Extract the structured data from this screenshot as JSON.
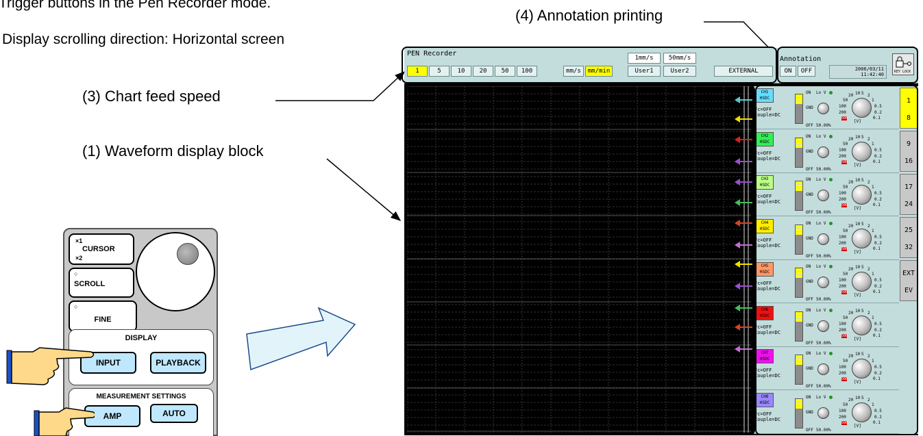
{
  "captions": {
    "line1": "Trigger buttons in the Pen Recorder mode.",
    "line2": "Display scrolling direction: Horizontal screen"
  },
  "callouts": {
    "annotation_printing": "(4) Annotation printing",
    "chart_feed_speed": "(3) Chart feed speed",
    "waveform_display_block": "(1) Waveform display block"
  },
  "screen": {
    "mode_title": "PEN Recorder",
    "speed_buttons": [
      {
        "label": "1",
        "selected": true
      },
      {
        "label": "5",
        "selected": false
      },
      {
        "label": "10",
        "selected": false
      },
      {
        "label": "20",
        "selected": false
      },
      {
        "label": "50",
        "selected": false
      },
      {
        "label": "100",
        "selected": false
      }
    ],
    "unit_mms": "mm/s",
    "unit_mmmin": "mm/min",
    "user_speeds": [
      "1mm/s",
      "50mm/s"
    ],
    "user1": "User1",
    "user2": "User2",
    "external": "EXTERNAL",
    "annotation": {
      "label": "Annotation",
      "on": "ON",
      "off": "OFF",
      "date": "2006/03/11",
      "time": "11:42:40"
    },
    "key_lock": "KEY LOCK",
    "side_tabs": [
      {
        "top": "1",
        "bottom": "8",
        "selected": true
      },
      {
        "top": "9",
        "bottom": "16",
        "selected": false
      },
      {
        "top": "17",
        "bottom": "24",
        "selected": false
      },
      {
        "top": "25",
        "bottom": "32",
        "selected": false
      },
      {
        "top": "EXT",
        "bottom": "EV",
        "selected": false
      }
    ],
    "channel_common": {
      "filter": "Fc=OFF",
      "coupling": "Couple=DC",
      "on": "ON",
      "lov": "Lo V",
      "gnd": "GND",
      "off": "OFF",
      "position": "50.00%",
      "range_unit": "[V]",
      "range_value": "500",
      "scale_20": "20",
      "scale_10": "10",
      "scale_5": "5",
      "scale_2": "2",
      "scale_50": "50",
      "scale_1": "1",
      "scale_100": "100",
      "scale_05": "0.5",
      "scale_200": "200",
      "scale_02": "0.2",
      "scale_01": "0.1"
    },
    "channels": [
      {
        "name": "CH1",
        "type": "HSDC",
        "color": "#66ddff",
        "marker": "#5bc8c8"
      },
      {
        "name": "CH2",
        "type": "HSDC",
        "color": "#33ee55",
        "marker": "#f0e000"
      },
      {
        "name": "CH3",
        "type": "HSDC",
        "color": "#bbff88",
        "marker": "#e02020"
      },
      {
        "name": "CH4",
        "type": "HSDC",
        "color": "#ffee00",
        "marker": "#9a50d0"
      },
      {
        "name": "CH5",
        "type": "HSDC",
        "color": "#ff9966",
        "marker": "#9a50d0"
      },
      {
        "name": "CH6",
        "type": "HSDC",
        "color": "#ee1111",
        "marker": "#40c060"
      },
      {
        "name": "CH7",
        "type": "HSDC",
        "color": "#ee11ee",
        "marker": "#e04020"
      },
      {
        "name": "CH8",
        "type": "HSDC",
        "color": "#9988ff",
        "marker": "#c070d0"
      }
    ],
    "extra_markers": [
      "#f0e000",
      "#9a50d0",
      "#40c060",
      "#e04020",
      "#c070d0"
    ]
  },
  "hardware": {
    "cursor_x1": "×1",
    "cursor_label": "CURSOR",
    "cursor_x2": "×2",
    "scroll": "SCROLL",
    "fine": "FINE",
    "display_group": "DISPLAY",
    "input": "INPUT",
    "playback": "PLAYBACK",
    "meas_group": "MEASUREMENT SETTINGS",
    "amp": "AMP",
    "auto": "AUTO"
  }
}
